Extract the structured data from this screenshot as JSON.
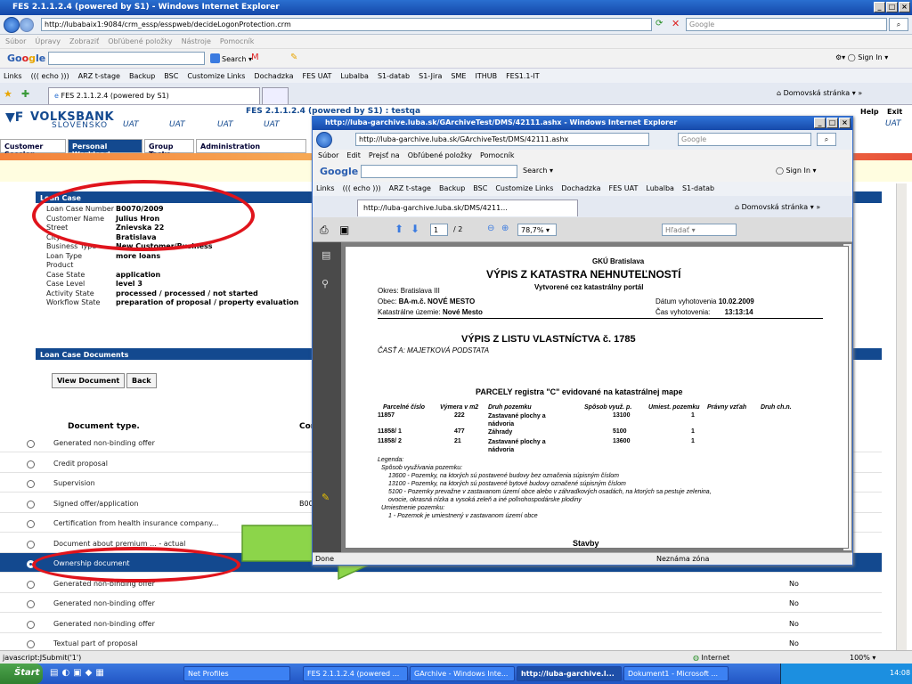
{
  "window": {
    "title": "FES 2.1.1.2.4 (powered by S1) - Windows Internet Explorer",
    "url": "http://lubabaix1:9084/crm_essp/esspweb/decideLogonProtection.crm",
    "search": "Google"
  },
  "menu": [
    "Súbor",
    "Úpravy",
    "Zobraziť",
    "Obľúbené položky",
    "Nástroje",
    "Pomocník"
  ],
  "google": {
    "search_label": "Search",
    "sign_in": "Sign In"
  },
  "links": {
    "title": "Links",
    "items": [
      "((( echo )))",
      "ARZ t-stage",
      "Backup",
      "BSC",
      "Customize Links",
      "Dochadzka",
      "FES UAT",
      "Lubalba",
      "S1-datab",
      "S1-Jira",
      "SME",
      "ITHUB",
      "FES1.1-IT"
    ]
  },
  "tab": {
    "label": "FES 2.1.1.2.4 (powered by S1)",
    "home": "Domovská stránka"
  },
  "app": {
    "logo": "VOLKSBANK",
    "logo_sub": "SLOVENSKO",
    "uat": [
      "UAT",
      "UAT",
      "UAT",
      "UAT"
    ],
    "header": "FES 2.1.1.2.4 (powered by S1) : testqa",
    "help": "Help",
    "exit": "Exit",
    "uat_right": "UAT"
  },
  "nav": [
    "Customer Session",
    "Personal Workload",
    "Group Tasks",
    "Administration"
  ],
  "loan": {
    "title": "Loan Case",
    "rows": [
      {
        "l": "Loan Case Number",
        "v": "B0070/2009"
      },
      {
        "l": "Customer Name",
        "v": "Julius Hron"
      },
      {
        "l": "Street",
        "v": "Znievska 22"
      },
      {
        "l": "City",
        "v": "Bratislava"
      },
      {
        "l": "Business Type",
        "v": "New Customer/Business"
      },
      {
        "l": "Loan Type",
        "v": "more loans"
      },
      {
        "l": "Product",
        "v": ""
      },
      {
        "l": "Case State",
        "v": "application"
      },
      {
        "l": "Case Level",
        "v": "level 3"
      },
      {
        "l": "Activity State",
        "v": "processed / processed / not started"
      },
      {
        "l": "Workflow State",
        "v": "preparation of proposal / property evaluation"
      }
    ]
  },
  "docs": {
    "title": "Loan Case Documents",
    "view": "View Document",
    "back": "Back",
    "col_type": "Document type.",
    "col2": "Cor",
    "rows": [
      {
        "t": "Generated non-binding offer",
        "c": "",
        "r": ""
      },
      {
        "t": "Credit proposal",
        "c": "",
        "r": ""
      },
      {
        "t": "Supervision",
        "c": "",
        "r": ""
      },
      {
        "t": "Signed offer/application",
        "c": "B00",
        "r": ""
      },
      {
        "t": "Certification from health insurance company...",
        "c": "",
        "r": ""
      },
      {
        "t": "Document about premium ... - actual",
        "c": "",
        "r": ""
      },
      {
        "t": "Ownership document",
        "c": "",
        "r": ""
      },
      {
        "t": "Generated non-binding offer",
        "c": "",
        "r": "No"
      },
      {
        "t": "Generated non-binding offer",
        "c": "",
        "r": "No"
      },
      {
        "t": "Generated non-binding offer",
        "c": "",
        "r": "No"
      },
      {
        "t": "Textual part of proposal",
        "c": "",
        "r": "No"
      }
    ]
  },
  "popup": {
    "title": "http://luba-garchive.luba.sk/GArchiveTest/DMS/42111.ashx - Windows Internet Explorer",
    "url": "http://luba-garchive.luba.sk/GArchiveTest/DMS/42111.ashx",
    "search": "Google",
    "menu": [
      "Súbor",
      "Edit",
      "Prejsť na",
      "Obľúbené položky",
      "Pomocník"
    ],
    "links": [
      "Links",
      "((( echo )))",
      "ARZ t-stage",
      "Backup",
      "BSC",
      "Customize Links",
      "Dochadzka",
      "FES UAT",
      "Lubalba",
      "S1-datab"
    ],
    "tab": "http://luba-garchive.luba.sk/DMS/4211...",
    "home": "Domovská stránka",
    "page": "1",
    "pages": "/ 2",
    "zoom": "78,7%",
    "find": "Hľadať",
    "status": "Done",
    "zone": "Neznáma zóna"
  },
  "pdf": {
    "org": "GKÚ Bratislava",
    "h1": "VÝPIS Z KATASTRA NEHNUTEĽNOSTÍ",
    "sub": "Vytvorené cez katastrálny portál",
    "okres": "Okres: Bratislava III",
    "obec_l": "Obec:",
    "obec": "BA-m.č. NOVÉ MESTO",
    "kat_l": "Katastrálne územie:",
    "kat": "Nové Mesto",
    "dat_l": "Dátum vyhotovenia",
    "dat": "10.02.2009",
    "cas_l": "Čas vyhotovenia:",
    "cas": "13:13:14",
    "h2": "VÝPIS Z LISTU VLASTNÍCTVA č.  1785",
    "part": "ČASŤ A: MAJETKOVÁ PODSTATA",
    "h3": "PARCELY registra \"C\" evidované na katastrálnej mape",
    "cols": [
      "Parcelné číslo",
      "Výmera v m2",
      "Druh pozemku",
      "Spôsob využ. p.",
      "Umiest. pozemku",
      "Právny vzťah",
      "Druh ch.n."
    ],
    "rows": [
      [
        "11857",
        "222",
        "Zastavané plochy a nádvoria",
        "13100",
        "1"
      ],
      [
        "11858/ 1",
        "477",
        "Záhrady",
        "5100",
        "1"
      ],
      [
        "11858/ 2",
        "21",
        "Zastavané plochy a nádvoria",
        "13600",
        "1"
      ]
    ],
    "legend": [
      "Legenda:",
      "Spôsob využívania pozemku:",
      "13600 - Pozemky, na ktorých sú postavené budovy bez označenia súpisným číslom",
      "13100 - Pozemky, na ktorých sú postavené bytové budovy označené súpisným číslom",
      "5100 - Pozemky prevažne v zastavanom území obce alebo v záhradkových osadách, na ktorých sa pestuje zelenina,",
      "ovocie, okrasná nízka a vysoká zeleň a iné poľnohospodárske plodiny",
      "Umiestnenie pozemku:",
      "1 - Pozemok je umiestnený v zastavanom území obce"
    ],
    "stavby": "Stavby"
  },
  "statusbar": {
    "text": "javascript:JSubmit('1')",
    "zone": "Internet",
    "zoom": "100%"
  },
  "taskbar": {
    "start": "Štart",
    "items": [
      "Net Profiles",
      "FES 2.1.1.2.4 (powered ...",
      "GArchive - Windows Inte...",
      "http://luba-garchive.l...",
      "Dokument1 - Microsoft ..."
    ],
    "time": "14:08"
  }
}
